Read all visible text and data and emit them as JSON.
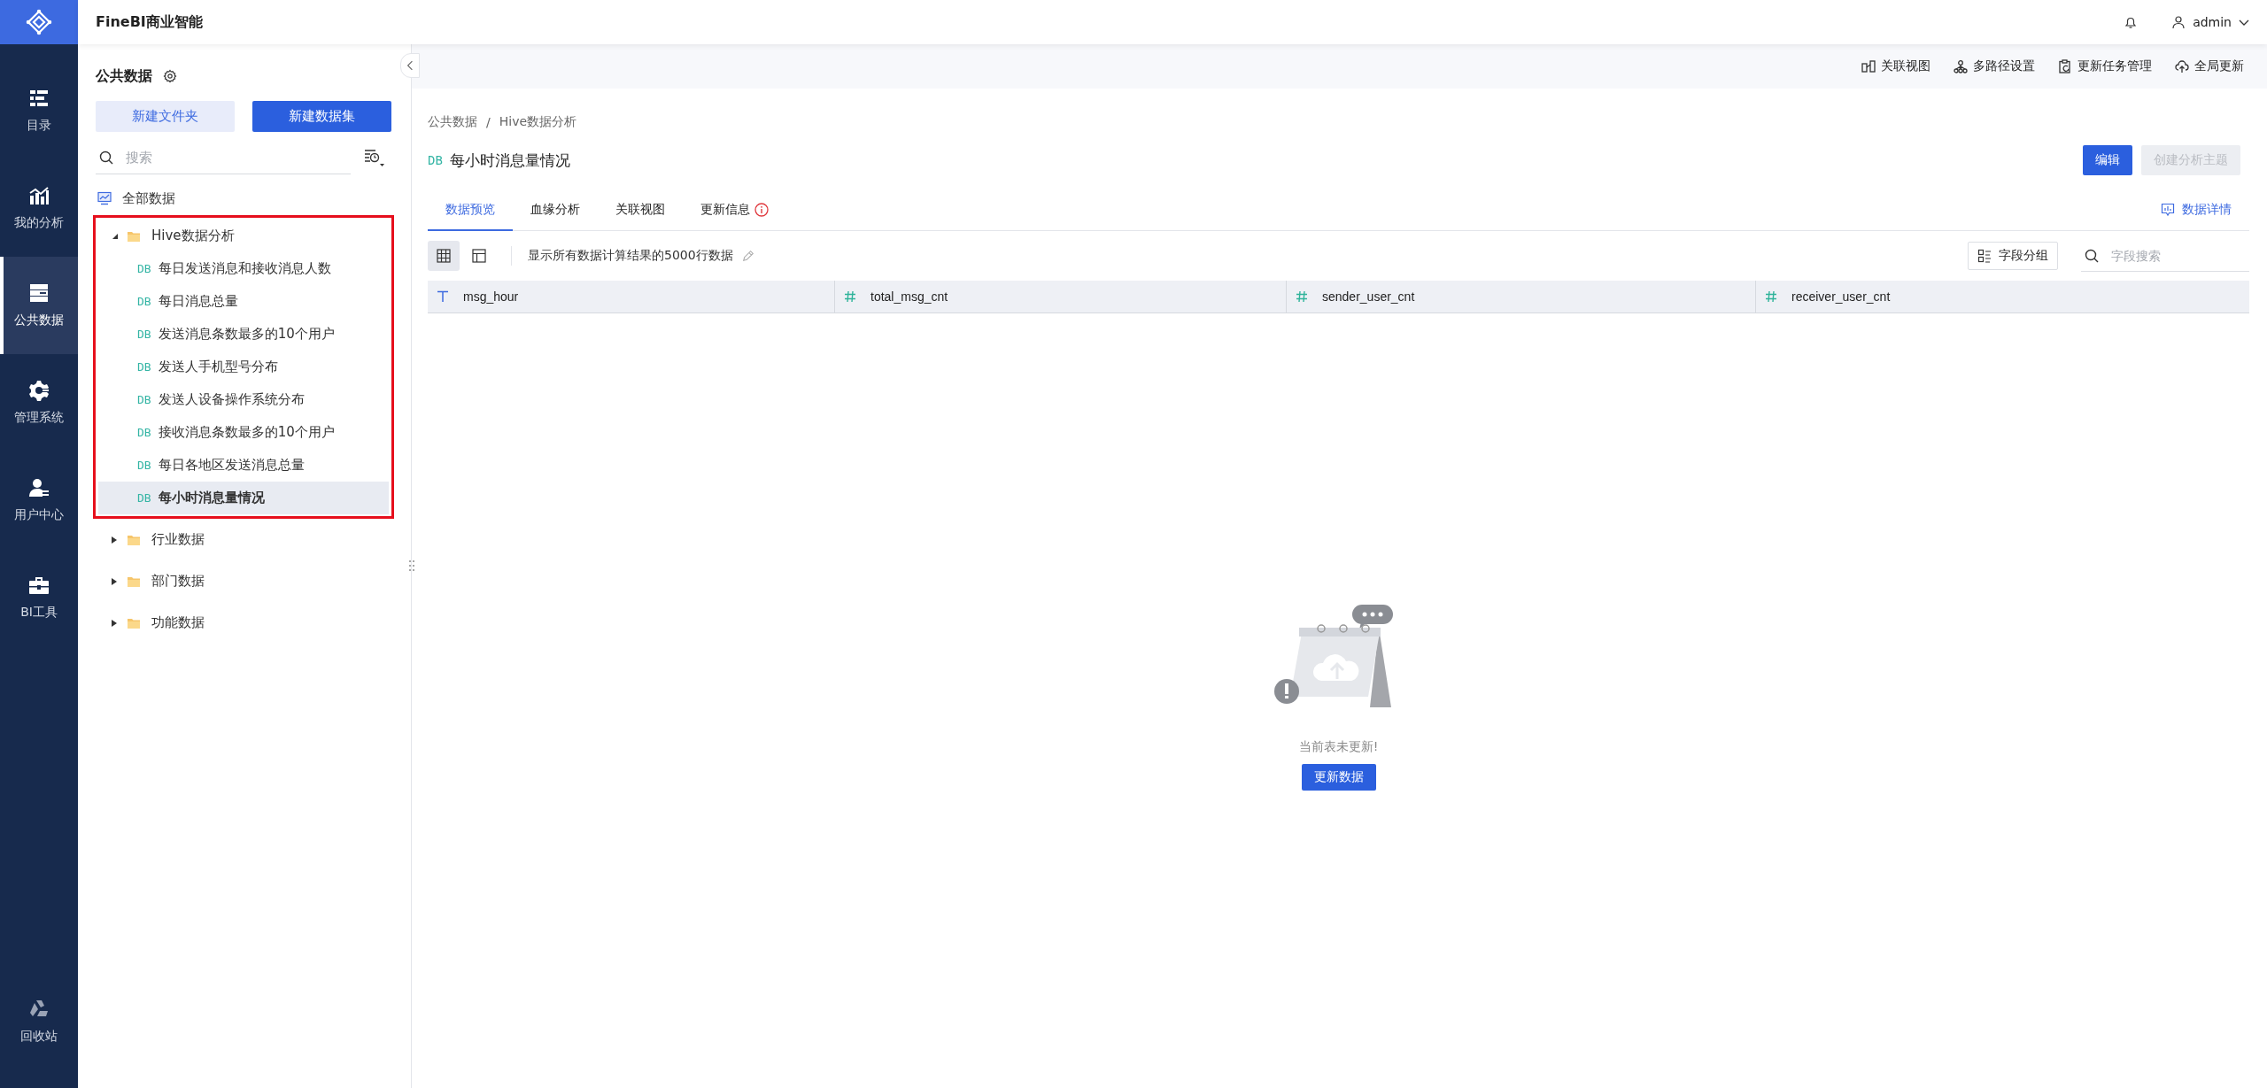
{
  "app": {
    "title": "FineBI商业智能"
  },
  "header": {
    "user": "admin"
  },
  "nav": {
    "items": [
      {
        "label": "目录",
        "selected": false
      },
      {
        "label": "我的分析",
        "selected": false
      },
      {
        "label": "公共数据",
        "selected": true
      },
      {
        "label": "管理系统",
        "selected": false
      },
      {
        "label": "用户中心",
        "selected": false
      },
      {
        "label": "BI工具",
        "selected": false
      }
    ],
    "bottom": {
      "label": "回收站"
    }
  },
  "sidebar": {
    "title": "公共数据",
    "buttons": [
      {
        "label": "新建文件夹",
        "kind": "secondary"
      },
      {
        "label": "新建数据集",
        "kind": "primary"
      }
    ],
    "search": {
      "placeholder": "搜索"
    },
    "root": {
      "label": "全部数据"
    },
    "tree": [
      {
        "label": "Hive数据分析",
        "expanded": true,
        "highlighted": true,
        "children": [
          {
            "tag": "DB",
            "label": "每日发送消息和接收消息人数",
            "selected": false
          },
          {
            "tag": "DB",
            "label": "每日消息总量",
            "selected": false
          },
          {
            "tag": "DB",
            "label": "发送消息条数最多的10个用户",
            "selected": false
          },
          {
            "tag": "DB",
            "label": "发送人手机型号分布",
            "selected": false
          },
          {
            "tag": "DB",
            "label": "发送人设备操作系统分布",
            "selected": false
          },
          {
            "tag": "DB",
            "label": "接收消息条数最多的10个用户",
            "selected": false
          },
          {
            "tag": "DB",
            "label": "每日各地区发送消息总量",
            "selected": false
          },
          {
            "tag": "DB",
            "label": "每小时消息量情况",
            "selected": true
          }
        ]
      },
      {
        "label": "行业数据",
        "expanded": false,
        "highlighted": false
      },
      {
        "label": "部门数据",
        "expanded": false,
        "highlighted": false
      },
      {
        "label": "功能数据",
        "expanded": false,
        "highlighted": false
      }
    ]
  },
  "toolbar": {
    "actions": [
      {
        "label": "关联视图"
      },
      {
        "label": "多路径设置"
      },
      {
        "label": "更新任务管理"
      },
      {
        "label": "全局更新"
      }
    ]
  },
  "breadcrumb": {
    "items": [
      "公共数据",
      "Hive数据分析"
    ],
    "separator": "/"
  },
  "dataset": {
    "tag": "DB",
    "title": "每小时消息量情况"
  },
  "actions": [
    {
      "label": "编辑",
      "disabled": false
    },
    {
      "label": "创建分析主题",
      "disabled": true
    }
  ],
  "tabs": [
    {
      "label": "数据预览",
      "selected": true,
      "alert": false
    },
    {
      "label": "血缘分析",
      "selected": false,
      "alert": false
    },
    {
      "label": "关联视图",
      "selected": false,
      "alert": false
    },
    {
      "label": "更新信息",
      "selected": false,
      "alert": true
    }
  ],
  "details_link": "数据详情",
  "view_modes": [
    {
      "selected": true
    },
    {
      "selected": false
    }
  ],
  "preview_note": "显示所有数据计算结果的5000行数据",
  "field_group_button": "字段分组",
  "field_search": {
    "placeholder": "字段搜索"
  },
  "table": {
    "columns": [
      {
        "name": "msg_hour",
        "kind": "text"
      },
      {
        "name": "total_msg_cnt",
        "kind": "number"
      },
      {
        "name": "sender_user_cnt",
        "kind": "number"
      },
      {
        "name": "receiver_user_cnt",
        "kind": "number"
      }
    ]
  },
  "empty_state": {
    "message": "当前表未更新!",
    "button": "更新数据"
  }
}
